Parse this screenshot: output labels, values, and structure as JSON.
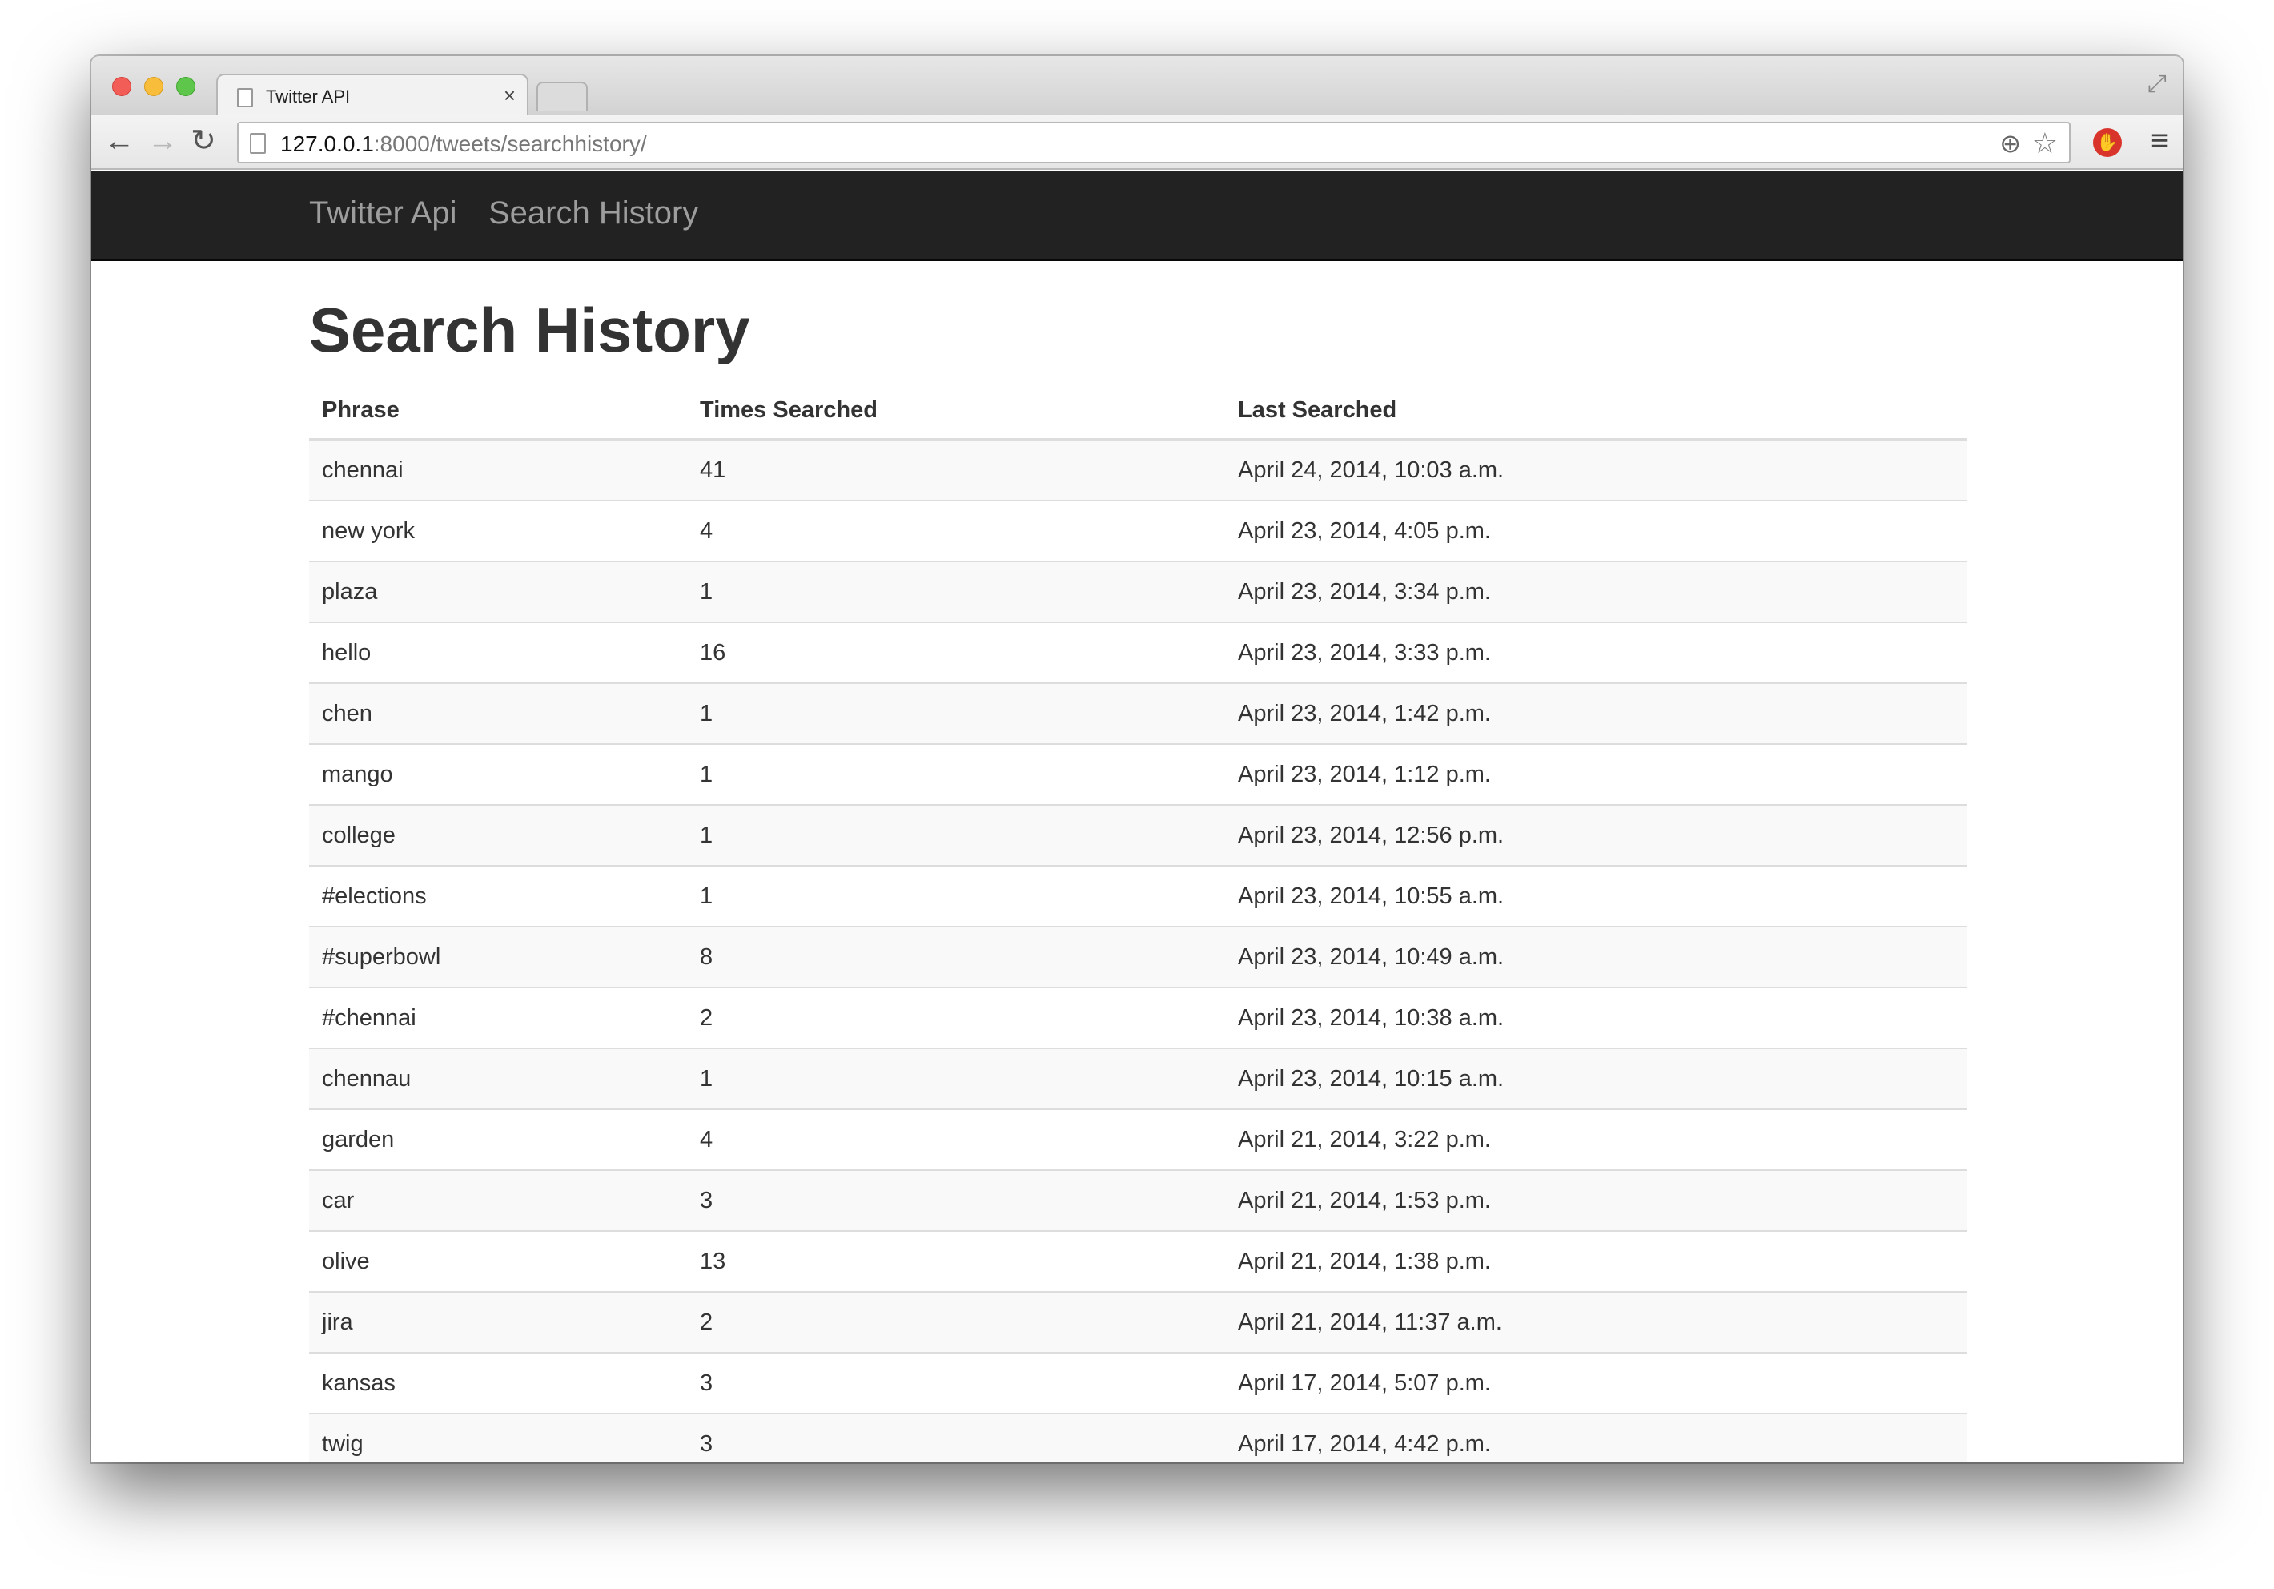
{
  "browser": {
    "tab_title": "Twitter API",
    "url_host": "127.0.0.1",
    "url_rest": ":8000/tweets/searchhistory/"
  },
  "navbar": {
    "brand": "Twitter Api",
    "link": "Search History"
  },
  "page": {
    "title": "Search History"
  },
  "table": {
    "headers": [
      "Phrase",
      "Times Searched",
      "Last Searched"
    ],
    "rows": [
      [
        "chennai",
        "41",
        "April 24, 2014, 10:03 a.m."
      ],
      [
        "new york",
        "4",
        "April 23, 2014, 4:05 p.m."
      ],
      [
        "plaza",
        "1",
        "April 23, 2014, 3:34 p.m."
      ],
      [
        "hello",
        "16",
        "April 23, 2014, 3:33 p.m."
      ],
      [
        "chen",
        "1",
        "April 23, 2014, 1:42 p.m."
      ],
      [
        "mango",
        "1",
        "April 23, 2014, 1:12 p.m."
      ],
      [
        "college",
        "1",
        "April 23, 2014, 12:56 p.m."
      ],
      [
        "#elections",
        "1",
        "April 23, 2014, 10:55 a.m."
      ],
      [
        "#superbowl",
        "8",
        "April 23, 2014, 10:49 a.m."
      ],
      [
        "#chennai",
        "2",
        "April 23, 2014, 10:38 a.m."
      ],
      [
        "chennau",
        "1",
        "April 23, 2014, 10:15 a.m."
      ],
      [
        "garden",
        "4",
        "April 21, 2014, 3:22 p.m."
      ],
      [
        "car",
        "3",
        "April 21, 2014, 1:53 p.m."
      ],
      [
        "olive",
        "13",
        "April 21, 2014, 1:38 p.m."
      ],
      [
        "jira",
        "2",
        "April 21, 2014, 11:37 a.m."
      ],
      [
        "kansas",
        "3",
        "April 17, 2014, 5:07 p.m."
      ],
      [
        "twig",
        "3",
        "April 17, 2014, 4:42 p.m."
      ]
    ]
  }
}
